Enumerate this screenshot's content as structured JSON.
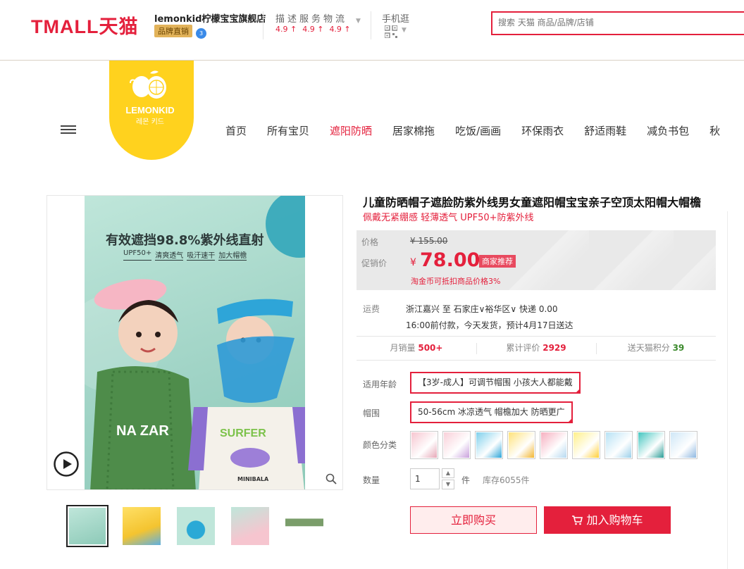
{
  "header": {
    "logo_text": "TMALL天猫",
    "shop_name": "lemonkid柠檬宝宝旗舰店",
    "brand_badge": "品牌直销",
    "rating_title": "描述服务物流",
    "ratings": [
      "4.9 ↑",
      "4.9 ↑",
      "4.9 ↑"
    ],
    "mobile_label": "手机逛",
    "search_placeholder": "搜索 天猫 商品/品牌/店铺"
  },
  "brand": {
    "name": "LEMONKID",
    "sub": "레몬 키드"
  },
  "nav": {
    "items": [
      "首页",
      "所有宝贝",
      "遮阳防晒",
      "居家棉拖",
      "吃饭/画画",
      "环保雨衣",
      "舒适雨鞋",
      "减负书包",
      "秋"
    ],
    "active_index": 2
  },
  "gallery": {
    "banner_title": "有效遮挡98.8%紫外线直射",
    "banner_tags": [
      "UPF50+",
      "清爽透气",
      "吸汗速干",
      "加大帽檐"
    ],
    "cap_text": "SURFER",
    "shirt_text": "MINIBALA",
    "shirt_text_2": "NA ZAR"
  },
  "product": {
    "title": "儿童防晒帽子遮脸防紫外线男女童遮阳帽宝宝亲子空顶太阳帽大帽檐",
    "subtitle": "佩戴无紧绷感 轻薄透气 UPF50+防紫外线",
    "price_label": "价格",
    "original_price": "¥ 155.00",
    "promo_label": "促销价",
    "currency": "¥",
    "promo_price": "78.00",
    "promo_badge": "商家推荐",
    "coin_note": "淘金币可抵扣商品价格3%",
    "shipping_label": "运费",
    "shipping_route": "浙江嘉兴 至 石家庄∨裕华区∨ 快递 0.00",
    "shipping_note": "16:00前付款，今天发货，预计4月17日送达",
    "stats": [
      {
        "label": "月销量",
        "value": "500+"
      },
      {
        "label": "累计评价",
        "value": "2929"
      },
      {
        "label": "送天猫积分",
        "value": "39"
      }
    ],
    "age_label": "适用年龄",
    "age_value": "【3岁-成人】可调节帽围 小孩大人都能戴",
    "size_label": "帽围",
    "size_value": "50-56cm 冰凉透气 帽檐加大 防晒更广",
    "color_label": "颜色分类",
    "qty_label": "数量",
    "qty_value": "1",
    "qty_unit": "件",
    "stock": "库存6055件",
    "buy_now": "立即购买",
    "add_cart": "加入购物车"
  },
  "colors": {
    "tmall_red": "#e4203c",
    "brand_yellow": "#ffd21e",
    "stat_green": "#3b8a2c"
  }
}
